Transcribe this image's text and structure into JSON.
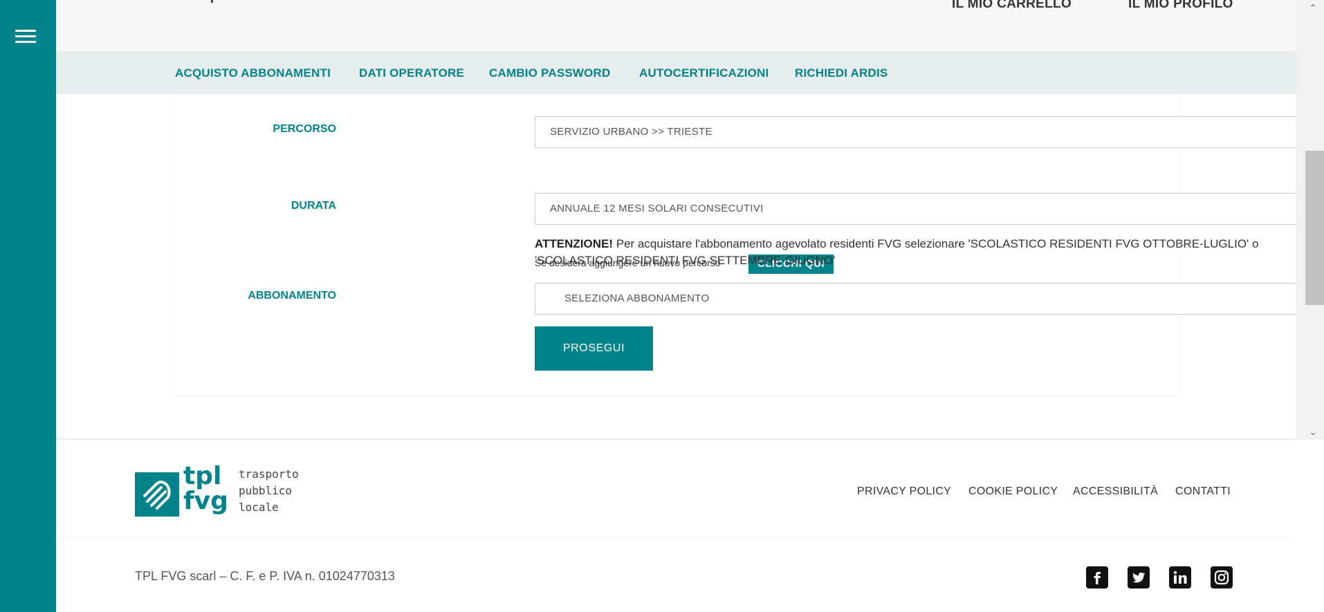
{
  "header": {
    "cart_label": "IL MIO CARRELLO",
    "profile_label": "IL MIO PROFILO"
  },
  "subnav": {
    "items": [
      {
        "label": "ACQUISTO ABBONAMENTI"
      },
      {
        "label": "DATI OPERATORE"
      },
      {
        "label": "CAMBIO PASSWORD"
      },
      {
        "label": "AUTOCERTIFICAZIONI"
      },
      {
        "label": "RICHIEDI ARDIS"
      }
    ]
  },
  "form": {
    "percorso": {
      "label": "PERCORSO",
      "value": "SERVIZIO URBANO >> TRIESTE"
    },
    "add_route_hint": "Se desidera aggiungere un nuovo percorso",
    "add_route_button": "CLICCHI QUI",
    "durata": {
      "label": "DURATA",
      "value": "ANNUALE 12 MESI SOLARI CONSECUTIVI"
    },
    "warning": {
      "prefix": "ATTENZIONE!",
      "text": " Per acquistare l'abbonamento agevolato residenti FVG selezionare 'SCOLASTICO RESIDENTI FVG OTTOBRE-LUGLIO' o 'SCOLASTICO RESIDENTI FVG SETTEMBRE-GIUGNO'"
    },
    "abbonamento": {
      "label": "ABBONAMENTO",
      "value": "SELEZIONA ABBONAMENTO"
    },
    "submit_label": "PROSEGUI"
  },
  "footer": {
    "brand": {
      "tpl": "tpl",
      "fvg": "fvg",
      "tagline": [
        "trasporto",
        "pubblico",
        "locale"
      ]
    },
    "links": [
      {
        "label": "PRIVACY POLICY"
      },
      {
        "label": "COOKIE POLICY"
      },
      {
        "label": "ACCESSIBILITÀ"
      },
      {
        "label": "CONTATTI"
      }
    ],
    "legal": "TPL FVG scarl – C. F. e P. IVA n. 01024770313",
    "social": [
      {
        "icon": "facebook-icon"
      },
      {
        "icon": "twitter-icon"
      },
      {
        "icon": "linkedin-icon"
      },
      {
        "icon": "instagram-icon"
      }
    ]
  },
  "colors": {
    "accent": "#00838a",
    "nav_bg": "#e7eced",
    "header_bg": "#f7f7f7"
  }
}
